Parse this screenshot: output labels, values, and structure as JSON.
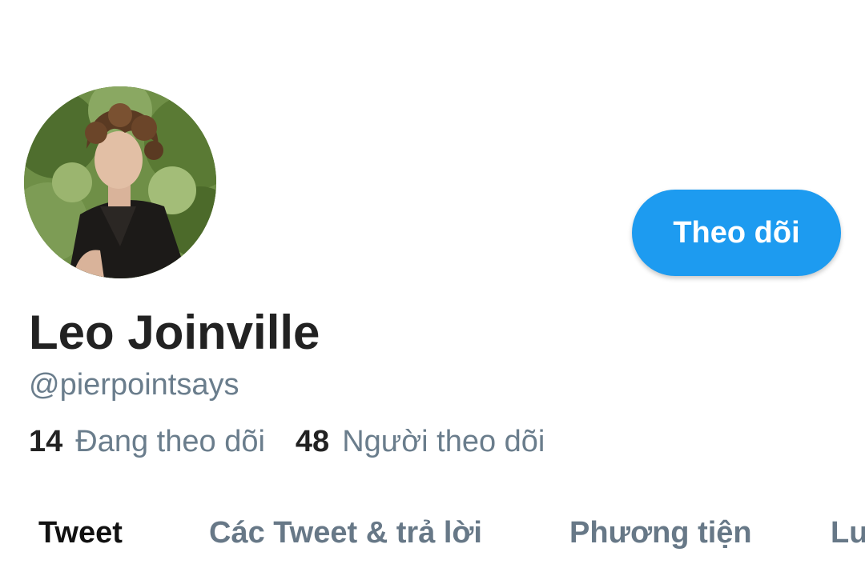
{
  "profile": {
    "display_name": "Leo Joinville",
    "handle": "@pierpointsays",
    "follow_button_label": "Theo dõi"
  },
  "stats": {
    "following_count": "14",
    "following_label": "Đang theo dõi",
    "followers_count": "48",
    "followers_label": "Người theo dõi"
  },
  "tabs": [
    {
      "label": "Tweet",
      "active": true
    },
    {
      "label": "Các Tweet & trả lời",
      "active": false
    },
    {
      "label": "Phương tiện",
      "active": false
    },
    {
      "label": "Lượt thích",
      "active": false
    }
  ],
  "colors": {
    "accent": "#1d9bf0",
    "text_primary": "#222222",
    "text_secondary": "#6a7d8c"
  }
}
